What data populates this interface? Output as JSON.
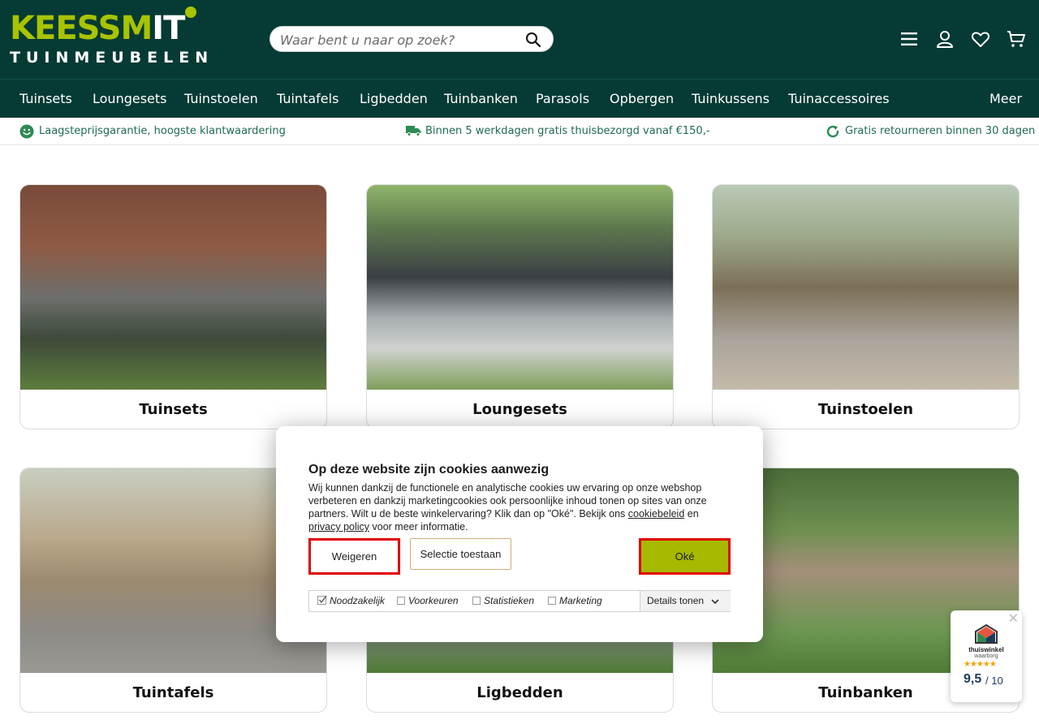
{
  "brand": {
    "line1_a": "KEESSM",
    "line1_b": "I",
    "line1_c": "T",
    "line2": "TUINMEUBELEN"
  },
  "search": {
    "placeholder": "Waar bent u naar op zoek?"
  },
  "header_icons": [
    "menu-icon",
    "account-icon",
    "heart-icon",
    "cart-icon"
  ],
  "nav": {
    "items": [
      "Tuinsets",
      "Loungesets",
      "Tuinstoelen",
      "Tuintafels",
      "Ligbedden",
      "Tuinbanken",
      "Parasols",
      "Opbergen",
      "Tuinkussens",
      "Tuinaccessoires"
    ],
    "more": "Meer"
  },
  "usp": [
    {
      "icon": "smiley-icon",
      "text": "Laagsteprijsgarantie, hoogste klantwaardering"
    },
    {
      "icon": "truck-icon",
      "text": "Binnen 5 werkdagen gratis thuisbezorgd vanaf €150,-"
    },
    {
      "icon": "refresh-icon",
      "text": "Gratis retourneren binnen 30 dagen"
    }
  ],
  "categories": [
    "Tuinsets",
    "Loungesets",
    "Tuinstoelen",
    "Tuintafels",
    "Ligbedden",
    "Tuinbanken"
  ],
  "cookie": {
    "title": "Op deze website zijn cookies aanwezig",
    "text_1": "Wij kunnen dankzij de functionele en analytische cookies uw ervaring op onze webshop verbeteren en dankzij marketingcookies ook persoonlijke inhoud tonen op sites van onze partners. Wilt u de beste winkelervaring? Klik dan op \"Oké\". Bekijk ons ",
    "link_1": "cookiebeleid",
    "text_2": " en ",
    "link_2": "privacy policy",
    "text_3": " voor meer informatie.",
    "btn_reject": "Weigeren",
    "btn_selection": "Selectie toestaan",
    "btn_accept": "Oké",
    "categories": [
      {
        "label": "Noodzakelijk",
        "checked": true
      },
      {
        "label": "Voorkeuren",
        "checked": false
      },
      {
        "label": "Statistieken",
        "checked": false
      },
      {
        "label": "Marketing",
        "checked": false
      }
    ],
    "details": "Details tonen"
  },
  "badge": {
    "close": "✕",
    "name": "thuiswinkel",
    "sub": "waarborg",
    "stars": "★★★★★",
    "score": "9,5",
    "max": "/ 10"
  },
  "colors": {
    "header_bg": "#053b34",
    "brand_green": "#a8c300",
    "usp_text": "#1f6b4f",
    "accept_bg": "#a7b900",
    "highlight_border": "#e00000"
  }
}
